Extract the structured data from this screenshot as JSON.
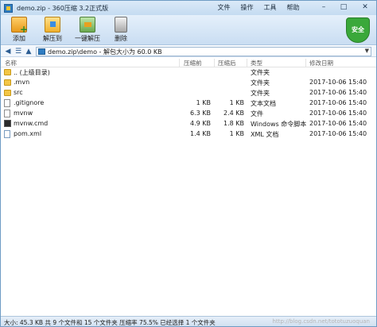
{
  "window": {
    "title": "demo.zip - 360压缩 3.2正式版",
    "menus": [
      "文件",
      "操作",
      "工具",
      "帮助"
    ],
    "controls": [
      "–",
      "□",
      "✕"
    ]
  },
  "toolbar": {
    "add_label": "添加",
    "extract_label": "解压到",
    "oneclick_label": "一键解压",
    "delete_label": "删除",
    "security_label": "安全"
  },
  "pathbar": {
    "address": "demo.zip\\demo - 解包大小为 60.0 KB"
  },
  "columns": {
    "name": "名称",
    "compressed": "压缩前",
    "original": "压缩后",
    "type": "类型",
    "modified": "修改日期"
  },
  "files": [
    {
      "icon": "folder",
      "name": ".. (上级目录)",
      "compressed": "",
      "original": "",
      "type": "文件夹",
      "modified": ""
    },
    {
      "icon": "folder",
      "name": ".mvn",
      "compressed": "",
      "original": "",
      "type": "文件夹",
      "modified": "2017-10-06 15:40"
    },
    {
      "icon": "folder",
      "name": "src",
      "compressed": "",
      "original": "",
      "type": "文件夹",
      "modified": "2017-10-06 15:40"
    },
    {
      "icon": "file",
      "name": ".gitignore",
      "compressed": "1 KB",
      "original": "1 KB",
      "type": "文本文档",
      "modified": "2017-10-06 15:40"
    },
    {
      "icon": "file",
      "name": "mvnw",
      "compressed": "6.3 KB",
      "original": "2.4 KB",
      "type": "文件",
      "modified": "2017-10-06 15:40"
    },
    {
      "icon": "cmd",
      "name": "mvnw.cmd",
      "compressed": "4.9 KB",
      "original": "1.8 KB",
      "type": "Windows 命令脚本",
      "modified": "2017-10-06 15:40"
    },
    {
      "icon": "xml",
      "name": "pom.xml",
      "compressed": "1.4 KB",
      "original": "1 KB",
      "type": "XML 文档",
      "modified": "2017-10-06 15:40"
    }
  ],
  "status": {
    "text": "大小: 45.3 KB 共 9 个文件和 15 个文件夹 压缩率 75.5% 已经选择 1 个文件夹",
    "watermark": "http://blog.csdn.net/tototuzuoquan"
  },
  "colors": {
    "titlebar": "#c4dbf1",
    "toolbar": "#c9ddf2",
    "security_badge": "#3aa83a",
    "folder": "#f3c647"
  }
}
